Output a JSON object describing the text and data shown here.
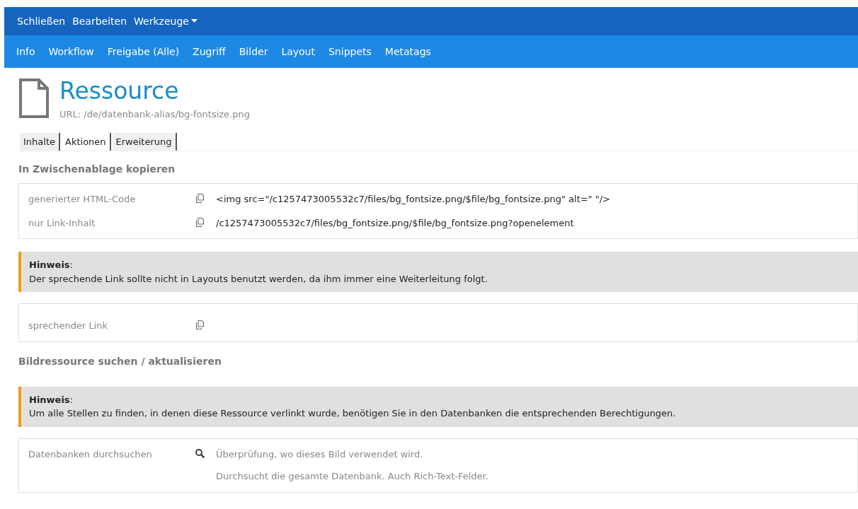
{
  "menu": [
    {
      "label": "Schließen",
      "dropdown": false
    },
    {
      "label": "Bearbeiten",
      "dropdown": false
    },
    {
      "label": "Werkzeuge",
      "dropdown": true
    }
  ],
  "nav": [
    "Info",
    "Workflow",
    "Freigabe (Alle)",
    "Zugriff",
    "Bilder",
    "Layout",
    "Snippets",
    "Metatags"
  ],
  "header": {
    "title": "Ressource",
    "url": "URL: /de/datenbank-alias/bg-fontsize.png"
  },
  "tabs": [
    {
      "label": "Inhalte",
      "selected": false
    },
    {
      "label": "Aktionen",
      "selected": true
    },
    {
      "label": "Erweiterung",
      "selected": false
    }
  ],
  "blocks": [
    {
      "kind": "heading",
      "text": "In Zwischenablage kopieren"
    },
    {
      "kind": "table",
      "rows": [
        {
          "label": "generierter HTML-Code",
          "kind": "copy",
          "lines": [
            "<img src=\"/c1257473005532c7/files/bg_fontsize.png/$file/bg_fontsize.png\" alt=\" \"/>"
          ]
        },
        {
          "label": "nur Link-Inhalt",
          "kind": "copy",
          "lines": [
            "/c1257473005532c7/files/bg_fontsize.png/$file/bg_fontsize.png?openelement"
          ]
        }
      ]
    },
    {
      "kind": "note",
      "text": "**Hinweis**:",
      "body": "Der sprechende Link sollte nicht in Layouts benutzt werden, da ihm immer eine Weiterleitung folgt."
    },
    {
      "kind": "table",
      "rows": [
        {
          "label": "sprechender Link",
          "kind": "copy",
          "lines": []
        }
      ]
    },
    {
      "kind": "heading",
      "text": "Bildressource suchen / aktualisieren"
    },
    {
      "kind": "note",
      "text": "**Hinweis**:",
      "body": "Um alle Stellen zu finden, in denen diese Ressource verlinkt wurde, benötigen Sie in den Datenbanken die entsprechenden Berechtigungen."
    },
    {
      "kind": "table",
      "rows": [
        {
          "label": "Datenbanken durchsuchen",
          "kind": "search",
          "lines": [
            "Überprüfung, wo dieses Bild verwendet wird.",
            "Durchsucht die gesamte Datenbank. Auch Rich-Text-Felder."
          ]
        }
      ]
    }
  ]
}
